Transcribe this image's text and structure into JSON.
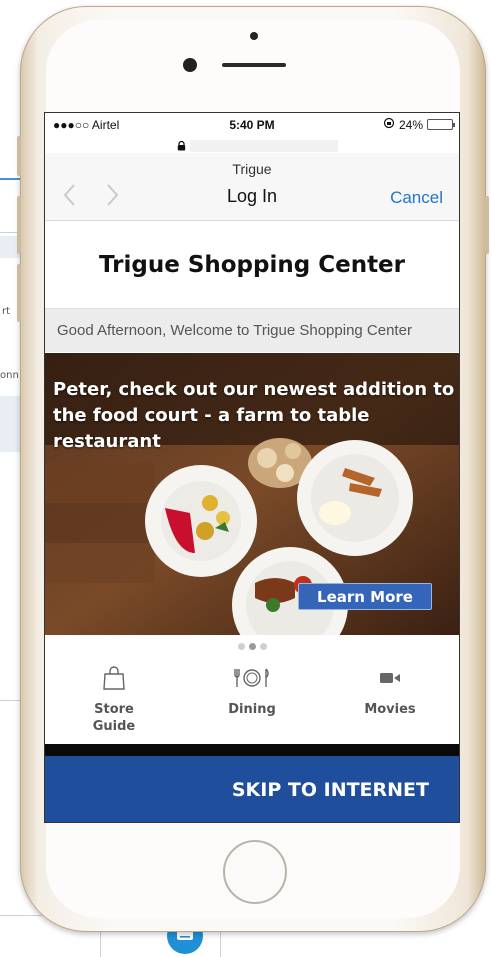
{
  "colors": {
    "accent": "#2176c8",
    "cta_blue": "#1f4f9c",
    "button_blue": "#3465b8",
    "battery": "#f3c21a"
  },
  "background": {
    "fragment_1": "rt",
    "fragment_2": "onn"
  },
  "status_bar": {
    "carrier": "●●●○○ Airtel",
    "time": "5:40 PM",
    "battery_percent": "24%",
    "battery_level": 0.24,
    "orientation_lock_icon": "orientation-lock-icon"
  },
  "browser": {
    "lock_icon": "lock-icon"
  },
  "nav": {
    "site_name": "Trigue",
    "title": "Log In",
    "cancel": "Cancel",
    "back_icon": "chevron-left-icon",
    "forward_icon": "chevron-right-icon"
  },
  "page": {
    "title": "Trigue Shopping Center",
    "greeting": "Good Afternoon, Welcome to Trigue Shopping Center"
  },
  "hero": {
    "text": "Peter, check out our newest addition to the food court  - a farm to table restaurant",
    "cta": "Learn More",
    "slides_total": 3,
    "active_slide": 1
  },
  "tiles": [
    {
      "label": "Store Guide",
      "icon": "shopping-bag-icon"
    },
    {
      "label": "Dining",
      "icon": "dining-icon"
    },
    {
      "label": "Movies",
      "icon": "video-camera-icon"
    }
  ],
  "footer": {
    "skip": "SKIP TO INTERNET"
  }
}
